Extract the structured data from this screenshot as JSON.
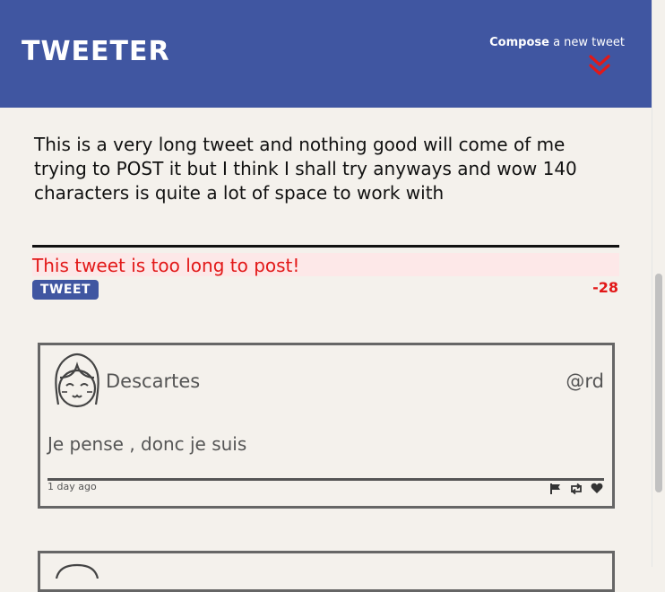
{
  "nav": {
    "brand": "TWEETER",
    "compose_bold": "Compose",
    "compose_rest": " a new tweet"
  },
  "composer": {
    "text": "This is a very long tweet and nothing good will come of me trying to POST it but I think I shall try anyways and wow 140 characters is quite a lot of space to work with",
    "error": "This tweet is too long to post!",
    "button": "TWEET",
    "counter": "-28"
  },
  "tweets": [
    {
      "author": "Descartes",
      "handle": "@rd",
      "content": "Je pense , donc je suis",
      "time": "1 day ago"
    }
  ],
  "colors": {
    "nav": "#4056a1",
    "background": "#f4f1ec",
    "error": "#e21818",
    "accent_chevron": "#e21818"
  }
}
